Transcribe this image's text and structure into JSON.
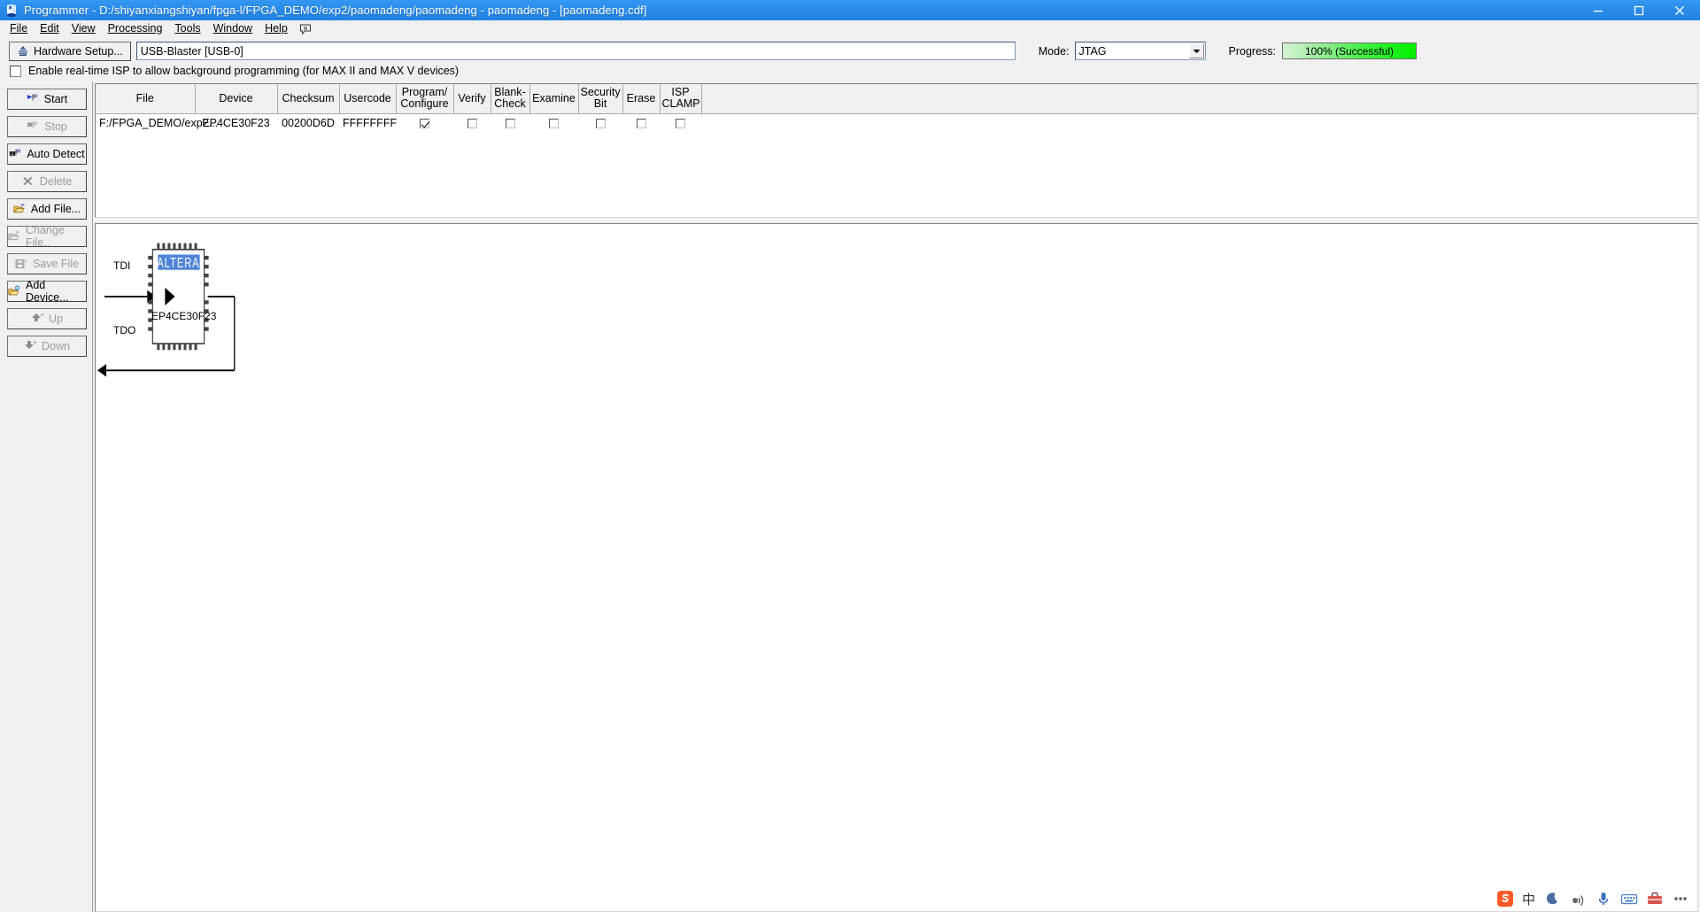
{
  "window": {
    "title": "Programmer - D:/shiyanxiangshiyan/fpga-l/FPGA_DEMO/exp2/paomadeng/paomadeng - paomadeng - [paomadeng.cdf]",
    "icon": "quartus-programmer-icon",
    "minimize": "minimize-button",
    "maximize": "maximize-button",
    "close": "close-button"
  },
  "menubar": {
    "items": [
      {
        "label": "File"
      },
      {
        "label": "Edit"
      },
      {
        "label": "View"
      },
      {
        "label": "Processing"
      },
      {
        "label": "Tools"
      },
      {
        "label": "Window"
      },
      {
        "label": "Help"
      }
    ]
  },
  "toolbar": {
    "hardware_setup_label": "Hardware Setup...",
    "hardware_value": "USB-Blaster [USB-0]",
    "mode_label": "Mode:",
    "mode_value": "JTAG",
    "progress_label": "Progress:",
    "progress_value": "100% (Successful)",
    "progress_color": "#00ef00",
    "isp_checkbox_label": "Enable real-time ISP to allow background programming (for MAX II and MAX V devices)",
    "isp_checked": false
  },
  "sidebar": {
    "buttons": [
      {
        "label": "Start",
        "icon": "start-flag-icon",
        "enabled": true
      },
      {
        "label": "Stop",
        "icon": "stop-flag-icon",
        "enabled": false
      },
      {
        "label": "Auto Detect",
        "icon": "auto-detect-icon",
        "enabled": true
      },
      {
        "label": "Delete",
        "icon": "delete-x-icon",
        "enabled": false
      },
      {
        "label": "Add File...",
        "icon": "add-file-icon",
        "enabled": true
      },
      {
        "label": "Change File..",
        "icon": "change-file-icon",
        "enabled": false
      },
      {
        "label": "Save File",
        "icon": "save-file-icon",
        "enabled": false
      },
      {
        "label": "Add Device...",
        "icon": "add-device-icon",
        "enabled": true
      },
      {
        "label": "Up",
        "icon": "arrow-up-icon",
        "enabled": false
      },
      {
        "label": "Down",
        "icon": "arrow-down-icon",
        "enabled": false
      }
    ]
  },
  "device_table": {
    "columns": [
      "File",
      "Device",
      "Checksum",
      "Usercode",
      "Program/ Configure",
      "Verify",
      "Blank- Check",
      "Examine",
      "Security Bit",
      "Erase",
      "ISP CLAMP"
    ],
    "column_lines": [
      [
        "File"
      ],
      [
        "Device"
      ],
      [
        "Checksum"
      ],
      [
        "Usercode"
      ],
      [
        "Program/",
        "Configure"
      ],
      [
        "Verify"
      ],
      [
        "Blank-",
        "Check"
      ],
      [
        "Examine"
      ],
      [
        "Security",
        "Bit"
      ],
      [
        "Erase"
      ],
      [
        "ISP",
        "CLAMP"
      ]
    ],
    "rows": [
      {
        "file": "F:/FPGA_DEMO/exp2...",
        "device": "EP4CE30F23",
        "checksum": "00200D6D",
        "usercode": "FFFFFFFF",
        "program_configure": true,
        "verify": false,
        "blank_check": false,
        "examine": false,
        "security_bit": false,
        "erase": false,
        "isp_clamp": false
      }
    ]
  },
  "chain_diagram": {
    "tdi_label": "TDI",
    "tdo_label": "TDO",
    "device_label": "EP4CE30F23",
    "device_brand": "ALTERA"
  },
  "tray": {
    "items": [
      {
        "icon": "sogou-s-icon",
        "label": "S"
      },
      {
        "icon": "chinese-mode-icon",
        "label": "中"
      },
      {
        "icon": "moon-icon",
        "label": ""
      },
      {
        "icon": "voice-icon",
        "label": ""
      },
      {
        "icon": "microphone-icon",
        "label": ""
      },
      {
        "icon": "keyboard-icon",
        "label": ""
      },
      {
        "icon": "toolbox-icon",
        "label": ""
      },
      {
        "icon": "menu-dots-icon",
        "label": ""
      }
    ]
  }
}
